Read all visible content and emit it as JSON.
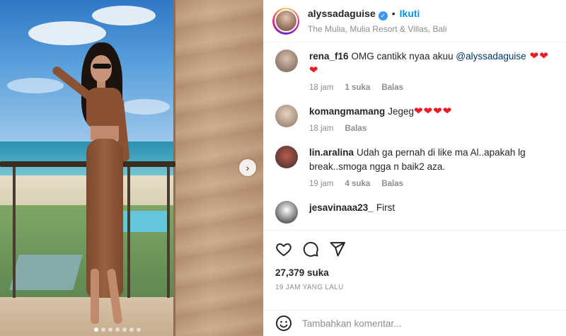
{
  "post": {
    "username": "alyssadaguise",
    "follow_label": "Ikuti",
    "separator": "•",
    "location": "The Mulia, Mulia Resort & Villas, Bali",
    "verified_icon": "verified-badge-icon",
    "next_icon": "chevron-right-icon",
    "carousel": {
      "slides": 7,
      "active_index": 0
    }
  },
  "comments": [
    {
      "username": "rena_f16",
      "text": "OMG cantikk nyaa akuu ",
      "mention": "@alyssadaguise",
      "hearts": " ❤❤❤",
      "time": "18 jam",
      "likes": "1 suka",
      "reply": "Balas"
    },
    {
      "username": "komangmamang",
      "text": "Jegeg",
      "hearts": "❤❤❤❤",
      "time": "18 jam",
      "reply": "Balas"
    },
    {
      "username": "lin.aralina",
      "text": "Udah ga pernah di like ma Al..apakah lg break..smoga ngga n baik2 aza.",
      "time": "19 jam",
      "likes": "4 suka",
      "reply": "Balas"
    },
    {
      "username": "jesavinaaa23_",
      "text": "First"
    }
  ],
  "actions": {
    "like_icon": "heart-icon",
    "comment_icon": "comment-icon",
    "share_icon": "share-icon",
    "likes_count": "27,379 suka",
    "posted_ago": "19 JAM YANG LALU"
  },
  "add_comment": {
    "placeholder": "Tambahkan komentar...",
    "emoji_icon": "emoji-icon"
  },
  "colors": {
    "follow": "#0095f6",
    "heart": "#ed1c24",
    "mention": "#00376b",
    "meta": "#8e8e8e"
  }
}
